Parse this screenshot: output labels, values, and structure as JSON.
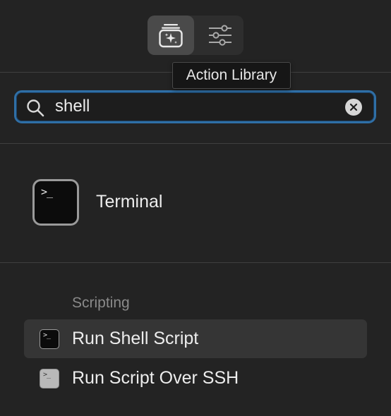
{
  "toolbar": {
    "buttons": [
      {
        "icon": "action-library-icon",
        "active": true
      },
      {
        "icon": "sliders-icon",
        "active": false
      }
    ],
    "tooltip": "Action Library"
  },
  "search": {
    "value": "shell",
    "placeholder": "",
    "accent": "#2f6fa6"
  },
  "top_hit": {
    "label": "Terminal",
    "icon": "terminal-app-icon",
    "glyph": ">_"
  },
  "section": {
    "header": "Scripting",
    "items": [
      {
        "label": "Run Shell Script",
        "icon": "terminal-script-icon",
        "glyph": ">_",
        "selected": true
      },
      {
        "label": "Run Script Over SSH",
        "icon": "ssh-script-icon",
        "glyph": ">_",
        "selected": false
      }
    ]
  }
}
